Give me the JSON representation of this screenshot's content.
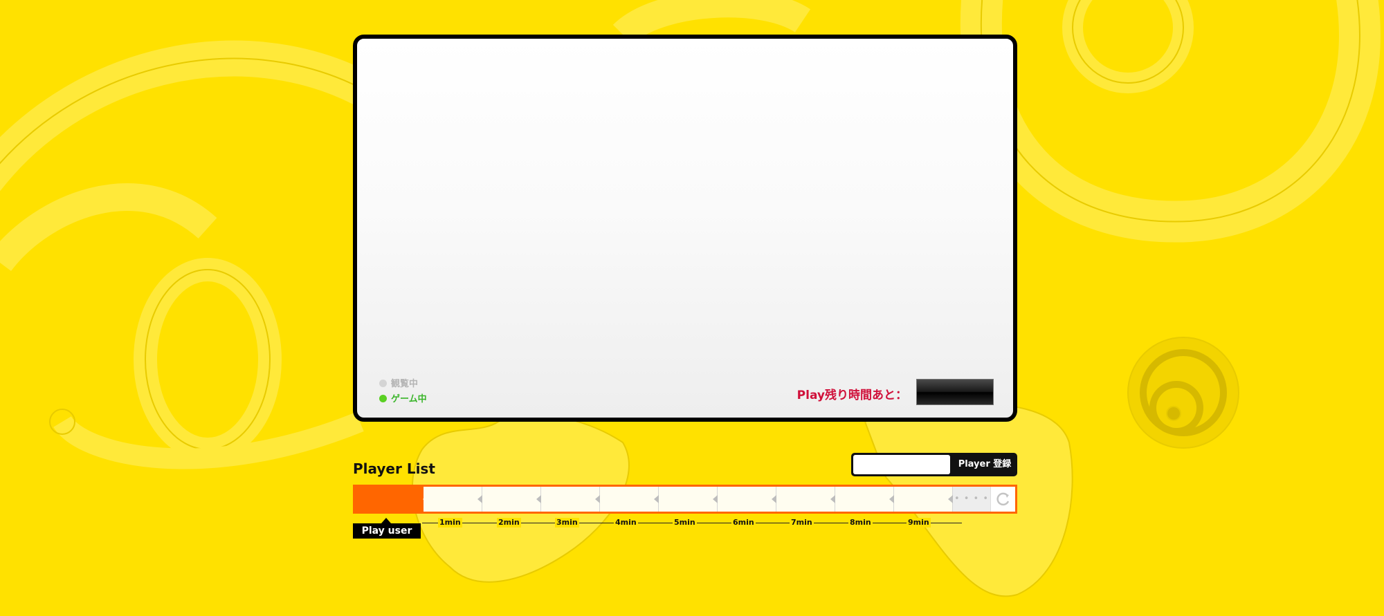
{
  "status": {
    "watching": "観覧中",
    "playing": "ゲーム中"
  },
  "timer": {
    "label": "Play残り時間あと：",
    "value": ""
  },
  "player_list": {
    "title": "Player List"
  },
  "register": {
    "input_value": "",
    "button_label": "Player 登録"
  },
  "timeline": {
    "more": "• • • •",
    "minutes": [
      "1min",
      "2min",
      "3min",
      "4min",
      "5min",
      "6min",
      "7min",
      "8min",
      "9min"
    ]
  },
  "play_user_label": "Play user",
  "colors": {
    "background": "#FFE100",
    "accent": "#FF6600",
    "timer_label": "#D0103A",
    "playing": "#3AB52A"
  }
}
